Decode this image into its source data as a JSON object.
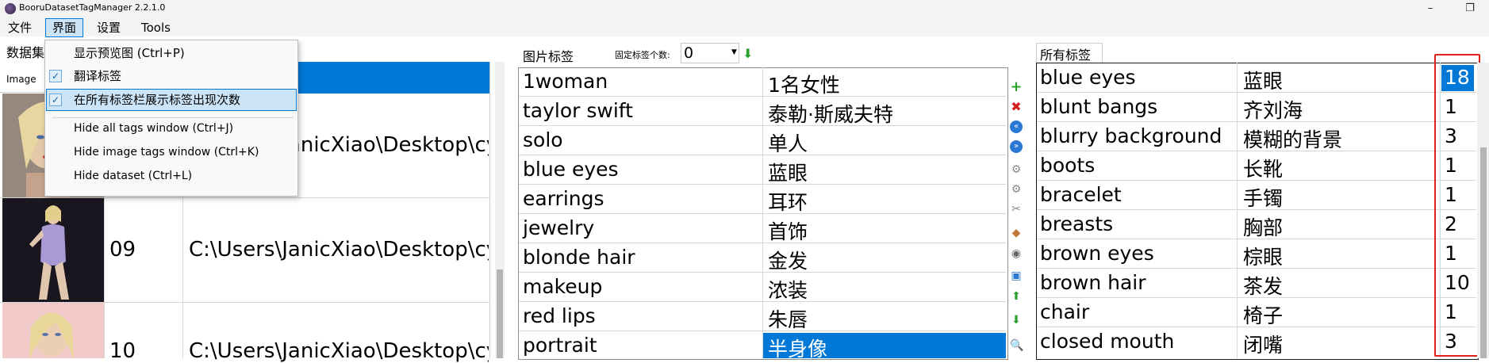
{
  "window": {
    "title": "BooruDatasetTagManager 2.2.1.0",
    "minimize_glyph": "–",
    "maximize_glyph": "❐"
  },
  "menubar": [
    "文件",
    "界面",
    "设置",
    "Tools"
  ],
  "view_menu": {
    "items": [
      {
        "label": "显示预览图 (Ctrl+P)",
        "checked": false,
        "highlighted": false
      },
      {
        "label": "翻译标签",
        "checked": true,
        "highlighted": false
      },
      {
        "label": "在所有标签栏展示标签出现次数",
        "checked": true,
        "highlighted": true
      },
      {
        "label": "Hide all tags window (Ctrl+J)",
        "checked": false,
        "highlighted": false
      },
      {
        "label": "Hide image tags window (Ctrl+K)",
        "checked": false,
        "highlighted": false
      },
      {
        "label": "Hide dataset (Ctrl+L)",
        "checked": false,
        "highlighted": false
      }
    ]
  },
  "dataset": {
    "title": "数据集",
    "column_image": "Image",
    "rows": [
      {
        "num": "",
        "path": "C:\\Users\\JanicXiao\\Desktop\\cy",
        "thumb_palette": "skin"
      },
      {
        "num": "09",
        "path": "C:\\Users\\JanicXiao\\Desktop\\cy",
        "thumb_palette": "dark"
      },
      {
        "num": "10",
        "path": "C:\\Users\\JanicXiao\\Desktop\\cy",
        "thumb_palette": "pink"
      }
    ]
  },
  "image_tags": {
    "title": "图片标签",
    "fixed_label": "固定标签个数:",
    "fixed_value": "0",
    "rows": [
      {
        "tag": "1woman",
        "translation": "1名女性"
      },
      {
        "tag": "taylor swift",
        "translation": "泰勒·斯威夫特"
      },
      {
        "tag": "solo",
        "translation": "单人"
      },
      {
        "tag": "blue eyes",
        "translation": "蓝眼"
      },
      {
        "tag": "earrings",
        "translation": "耳环"
      },
      {
        "tag": "jewelry",
        "translation": "首饰"
      },
      {
        "tag": "blonde hair",
        "translation": "金发"
      },
      {
        "tag": "makeup",
        "translation": "浓装"
      },
      {
        "tag": "red lips",
        "translation": "朱唇"
      },
      {
        "tag": "portrait",
        "translation": "半身像"
      }
    ]
  },
  "toolbar": [
    "add-icon",
    "delete-icon",
    "move-up-all-icon",
    "move-down-all-icon",
    "tool-icon",
    "tool-icon",
    "tool-icon",
    "erase-icon",
    "tool-icon",
    "image-icon",
    "arrow-up-icon",
    "arrow-down-icon",
    "search-icon"
  ],
  "all_tags": {
    "title": "所有标签",
    "rows": [
      {
        "tag": "blue eyes",
        "translation": "蓝眼",
        "count": "18"
      },
      {
        "tag": "blunt bangs",
        "translation": "齐刘海",
        "count": "1"
      },
      {
        "tag": "blurry background",
        "translation": "模糊的背景",
        "count": "3"
      },
      {
        "tag": "boots",
        "translation": "长靴",
        "count": "1"
      },
      {
        "tag": "bracelet",
        "translation": "手镯",
        "count": "1"
      },
      {
        "tag": "breasts",
        "translation": "胸部",
        "count": "2"
      },
      {
        "tag": "brown eyes",
        "translation": "棕眼",
        "count": "1"
      },
      {
        "tag": "brown hair",
        "translation": "茶发",
        "count": "10"
      },
      {
        "tag": "chair",
        "translation": "椅子",
        "count": "1"
      },
      {
        "tag": "closed mouth",
        "translation": "闭嘴",
        "count": "3"
      }
    ]
  },
  "colors": {
    "selection": "#0078d7",
    "highlight_box": "#e0211b",
    "menu_highlight": "#cce4f7"
  }
}
